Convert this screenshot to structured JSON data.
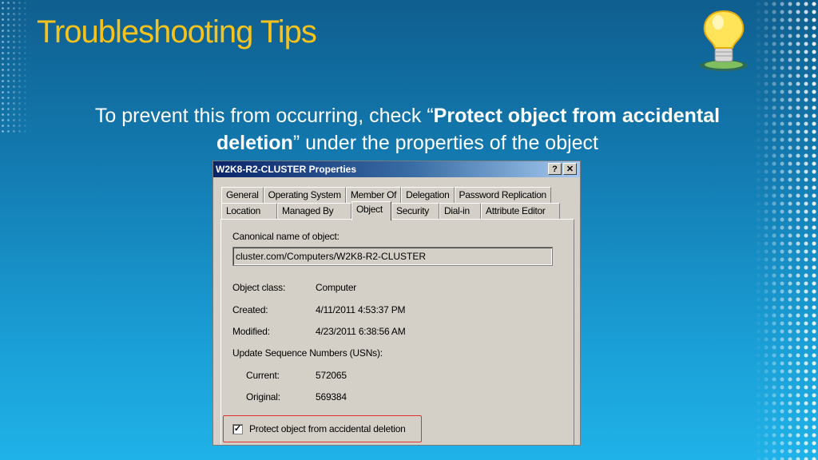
{
  "slide": {
    "title": "Troubleshooting Tips",
    "body_prefix": "To prevent this from occurring, check “",
    "body_bold": "Protect object from accidental deletion",
    "body_suffix": "” under the properties of the object",
    "title_color": "#f6c21b",
    "decor_icon": "lightbulb-icon"
  },
  "dialog": {
    "title": "W2K8-R2-CLUSTER Properties",
    "help_btn": "?",
    "close_btn": "✕",
    "tabs_row1": [
      "General",
      "Operating System",
      "Member Of",
      "Delegation",
      "Password Replication"
    ],
    "tabs_row2": [
      "Location",
      "Managed By",
      "Object",
      "Security",
      "Dial-in",
      "Attribute Editor"
    ],
    "active_tab": "Object",
    "canonical_label": "Canonical name of object:",
    "canonical_value": "cluster.com/Computers/W2K8-R2-CLUSTER",
    "object_class_label": "Object class:",
    "object_class_value": "Computer",
    "created_label": "Created:",
    "created_value": "4/11/2011 4:53:37 PM",
    "modified_label": "Modified:",
    "modified_value": "4/23/2011 6:38:56 AM",
    "usn_label": "Update Sequence Numbers (USNs):",
    "current_label": "Current:",
    "current_value": "572065",
    "original_label": "Original:",
    "original_value": "569384",
    "protect_label": "Protect object from accidental deletion",
    "protect_checked": true,
    "highlight_color": "#e0322f"
  }
}
